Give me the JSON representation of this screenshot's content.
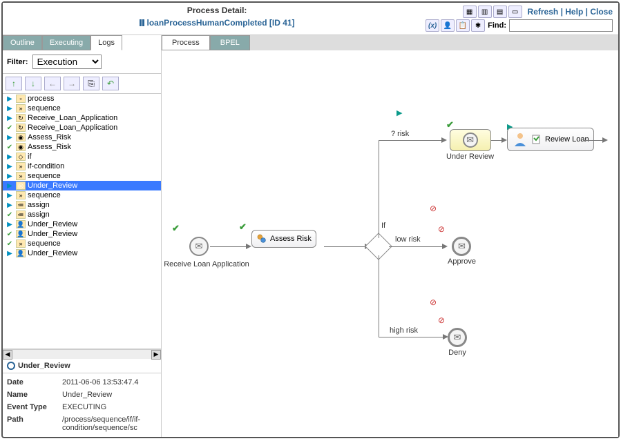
{
  "header": {
    "title_label": "Process Detail:",
    "process_name": "loanProcessHumanCompleted [ID 41]",
    "links": {
      "refresh": "Refresh",
      "help": "Help",
      "close": "Close"
    },
    "find_label": "Find:",
    "find_value": ""
  },
  "sidebar": {
    "tabs": {
      "outline": "Outline",
      "executing": "Executing",
      "logs": "Logs"
    },
    "active_tab": "logs",
    "filter_label": "Filter:",
    "filter_value": "Execution",
    "tree": [
      {
        "status": "play",
        "icon": "box",
        "label": "process"
      },
      {
        "status": "play",
        "icon": "seq",
        "label": "sequence"
      },
      {
        "status": "play",
        "icon": "rec",
        "label": "Receive_Loan_Application"
      },
      {
        "status": "check",
        "icon": "rec",
        "label": "Receive_Loan_Application"
      },
      {
        "status": "play",
        "icon": "inv",
        "label": "Assess_Risk"
      },
      {
        "status": "check",
        "icon": "inv",
        "label": "Assess_Risk"
      },
      {
        "status": "play",
        "icon": "if",
        "label": "if"
      },
      {
        "status": "play",
        "icon": "seq",
        "label": "if-condition"
      },
      {
        "status": "play",
        "icon": "seq",
        "label": "sequence"
      },
      {
        "status": "play",
        "icon": "ring",
        "label": "Under_Review",
        "selected": true
      },
      {
        "status": "play",
        "icon": "seq",
        "label": "sequence"
      },
      {
        "status": "play",
        "icon": "asg",
        "label": "assign"
      },
      {
        "status": "check",
        "icon": "asg",
        "label": "assign"
      },
      {
        "status": "play",
        "icon": "task",
        "label": "Under_Review"
      },
      {
        "status": "check",
        "icon": "task",
        "label": "Under_Review"
      },
      {
        "status": "check",
        "icon": "seq",
        "label": "sequence"
      },
      {
        "status": "play",
        "icon": "task",
        "label": "Under_Review"
      }
    ],
    "selected_header": "Under_Review",
    "details": {
      "date_label": "Date",
      "date": "2011-06-06 13:53:47.4",
      "name_label": "Name",
      "name": "Under_Review",
      "event_label": "Event Type",
      "event": "EXECUTING",
      "path_label": "Path",
      "path": "/process/sequence/if/if-condition/sequence/sc"
    }
  },
  "main": {
    "tabs": {
      "process": "Process",
      "bpel": "BPEL"
    },
    "active_tab": "process",
    "nodes": {
      "receive": "Receive Loan Application",
      "assess": "Assess Risk",
      "gateway_label": "If",
      "risk_edge": "? risk",
      "low_edge": "low risk",
      "high_edge": "high risk",
      "under_review": "Under Review",
      "approve": "Approve",
      "deny": "Deny",
      "review_loan": "Review Loan"
    }
  }
}
